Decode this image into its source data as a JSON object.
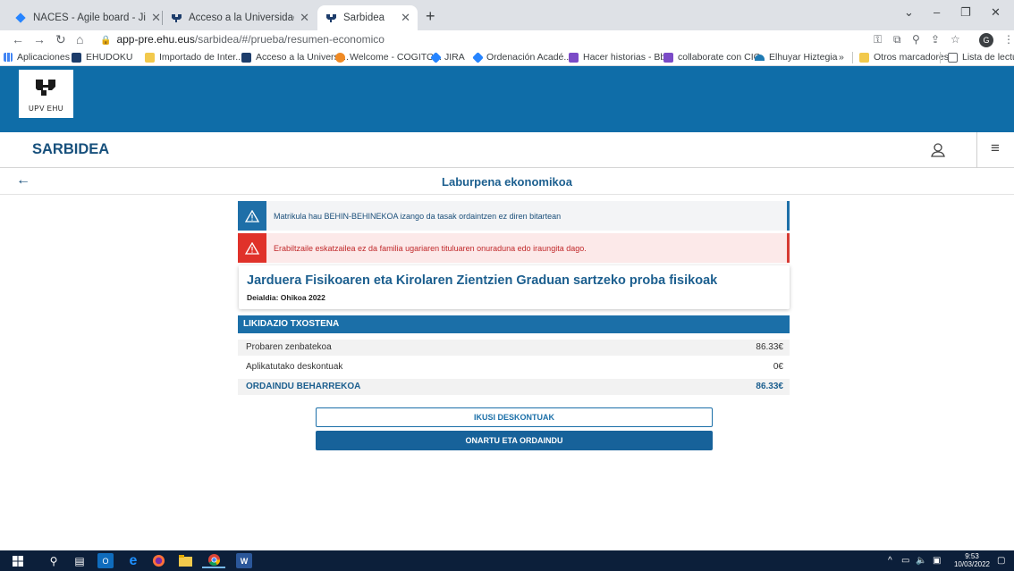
{
  "browser": {
    "tabs": [
      {
        "title": "NACES - Agile board - Jira",
        "icon": "jira-icon"
      },
      {
        "title": "Acceso a la Universidad - UPV/EH",
        "icon": "upv-ehu-icon"
      },
      {
        "title": "Sarbidea",
        "icon": "upv-ehu-icon",
        "active": true
      }
    ],
    "url_host": "app-pre.ehu.eus",
    "url_path": "/sarbidea/#/prueba/resumen-economico",
    "profile_initial": "G",
    "bookmarks": [
      {
        "label": "Aplicaciones",
        "icon": "apps-grid-icon"
      },
      {
        "label": "EHUDOKU",
        "icon": "upv-ehu-icon"
      },
      {
        "label": "Importado de Inter...",
        "icon": "folder-icon"
      },
      {
        "label": "Acceso a la Universi...",
        "icon": "upv-ehu-icon"
      },
      {
        "label": "Welcome - COGITO...",
        "icon": "cogito-icon"
      },
      {
        "label": "JIRA",
        "icon": "jira-icon"
      },
      {
        "label": "Ordenación Acadé...",
        "icon": "jira-icon"
      },
      {
        "label": "Hacer historias - Bb...",
        "icon": "purple-square-icon"
      },
      {
        "label": "collaborate con CIG",
        "icon": "purple-square-icon"
      },
      {
        "label": "Elhuyar Hiztegia",
        "icon": "elhuyar-icon"
      },
      {
        "label": "»",
        "icon": ""
      },
      {
        "label": "Otros marcadores",
        "icon": "folder-icon"
      },
      {
        "label": "Lista de lectura",
        "icon": "reading-list-icon"
      }
    ]
  },
  "app": {
    "logo_text": "UPV   EHU",
    "title": "SARBIDEA",
    "page_title": "Laburpena ekonomikoa",
    "brand_color": "#0f6da8"
  },
  "alerts": {
    "info": "Matrikula hau BEHIN-BEHINEKOA izango da tasak ordaintzen ez diren bitartean",
    "error": "Erabiltzaile eskatzailea ez da familia ugariaren tituluaren onuraduna edo iraungita dago."
  },
  "course": {
    "title": "Jarduera Fisikoaren eta Kirolaren Zientzien Graduan sartzeko proba fisikoak",
    "call": "Deialdia: Ohikoa 2022"
  },
  "settlement": {
    "header": "LIKIDAZIO TXOSTENA",
    "rows": [
      {
        "label": "Probaren zenbatekoa",
        "value": "86.33€"
      },
      {
        "label": "Aplikatutako deskontuak",
        "value": "0€"
      },
      {
        "label": "ORDAINDU BEHARREKOA",
        "value": "86.33€"
      }
    ]
  },
  "buttons": {
    "view_discounts": "IKUSI DESKONTUAK",
    "accept_pay": "ONARTU ETA ORDAINDU"
  },
  "taskbar": {
    "time": "9:53",
    "date": "10/03/2022"
  }
}
